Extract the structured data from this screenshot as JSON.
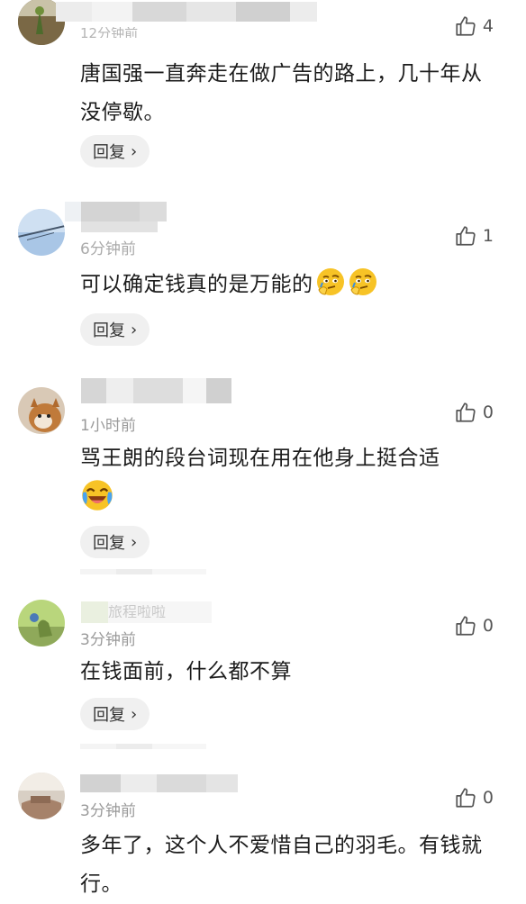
{
  "comments": [
    {
      "time": "12分钟前",
      "likes": "4",
      "text": "唐国强一直奔走在做广告的路上，几十年从没停歇。",
      "reply_label": "回复"
    },
    {
      "time": "6分钟前",
      "likes": "1",
      "text": "可以确定钱真的是万能的",
      "emojis": [
        "thinking-face-icon",
        "thinking-face-icon"
      ],
      "reply_label": "回复"
    },
    {
      "time": "1小时前",
      "likes": "0",
      "text": "骂王朗的段台词现在用在他身上挺合适",
      "emojis": [
        "laughing-crying-face-icon"
      ],
      "reply_label": "回复"
    },
    {
      "time": "3分钟前",
      "likes": "0",
      "name_partial": "旅程啦啦",
      "text": "在钱面前，什么都不算",
      "reply_label": "回复"
    },
    {
      "time": "3分钟前",
      "likes": "0",
      "text": "多年了，这个人不爱惜自己的羽毛。有钱就行。"
    }
  ],
  "colors": {
    "time_text": "#9a9a9a",
    "reply_bg": "#f0f0f0",
    "emoji_yellow": "#f7c326"
  }
}
